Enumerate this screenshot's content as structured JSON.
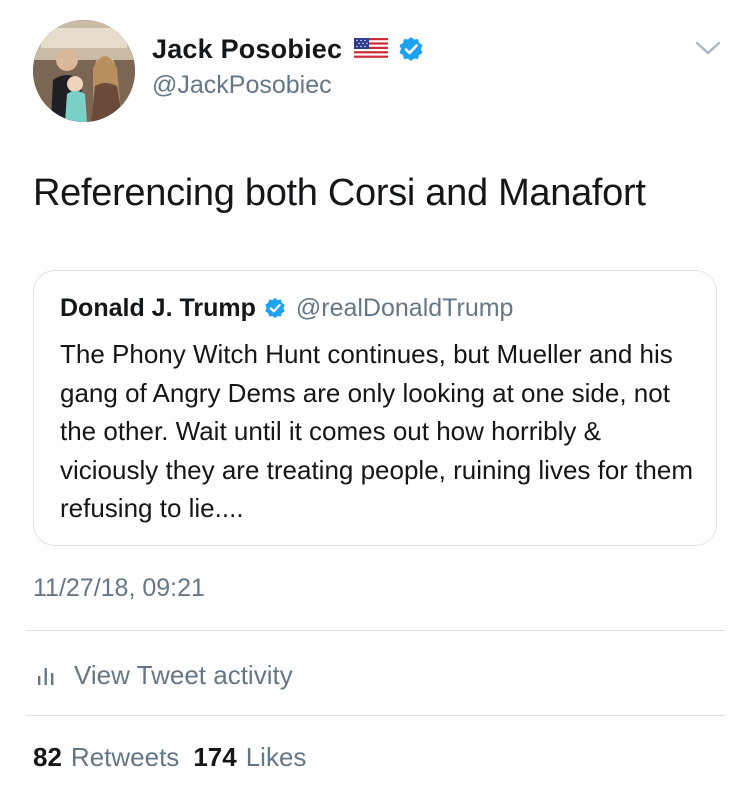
{
  "author": {
    "display_name": "Jack Posobiec",
    "handle": "@JackPosobiec",
    "flag": "us-flag-emoji",
    "verified": true,
    "avatar": "profile-photo"
  },
  "tweet": {
    "text": "Referencing both Corsi and Manafort",
    "timestamp": "11/27/18, 09:21"
  },
  "quoted_tweet": {
    "display_name": "Donald J. Trump",
    "handle": "@realDonaldTrump",
    "verified": true,
    "text": "The Phony Witch Hunt continues, but Mueller and his gang of Angry Dems are only looking at one side, not the other. Wait until it comes out how horribly & viciously they are treating people, ruining lives for them refusing to lie...."
  },
  "actions": {
    "activity_label": "View Tweet activity",
    "activity_icon": "bar-chart-icon",
    "menu_icon": "chevron-down-icon"
  },
  "stats": {
    "retweets_count": "82",
    "retweets_label": "Retweets",
    "likes_count": "174",
    "likes_label": "Likes"
  },
  "colors": {
    "verified_blue": "#1da1f2",
    "secondary_text": "#657786",
    "border": "#dfe3e7"
  }
}
